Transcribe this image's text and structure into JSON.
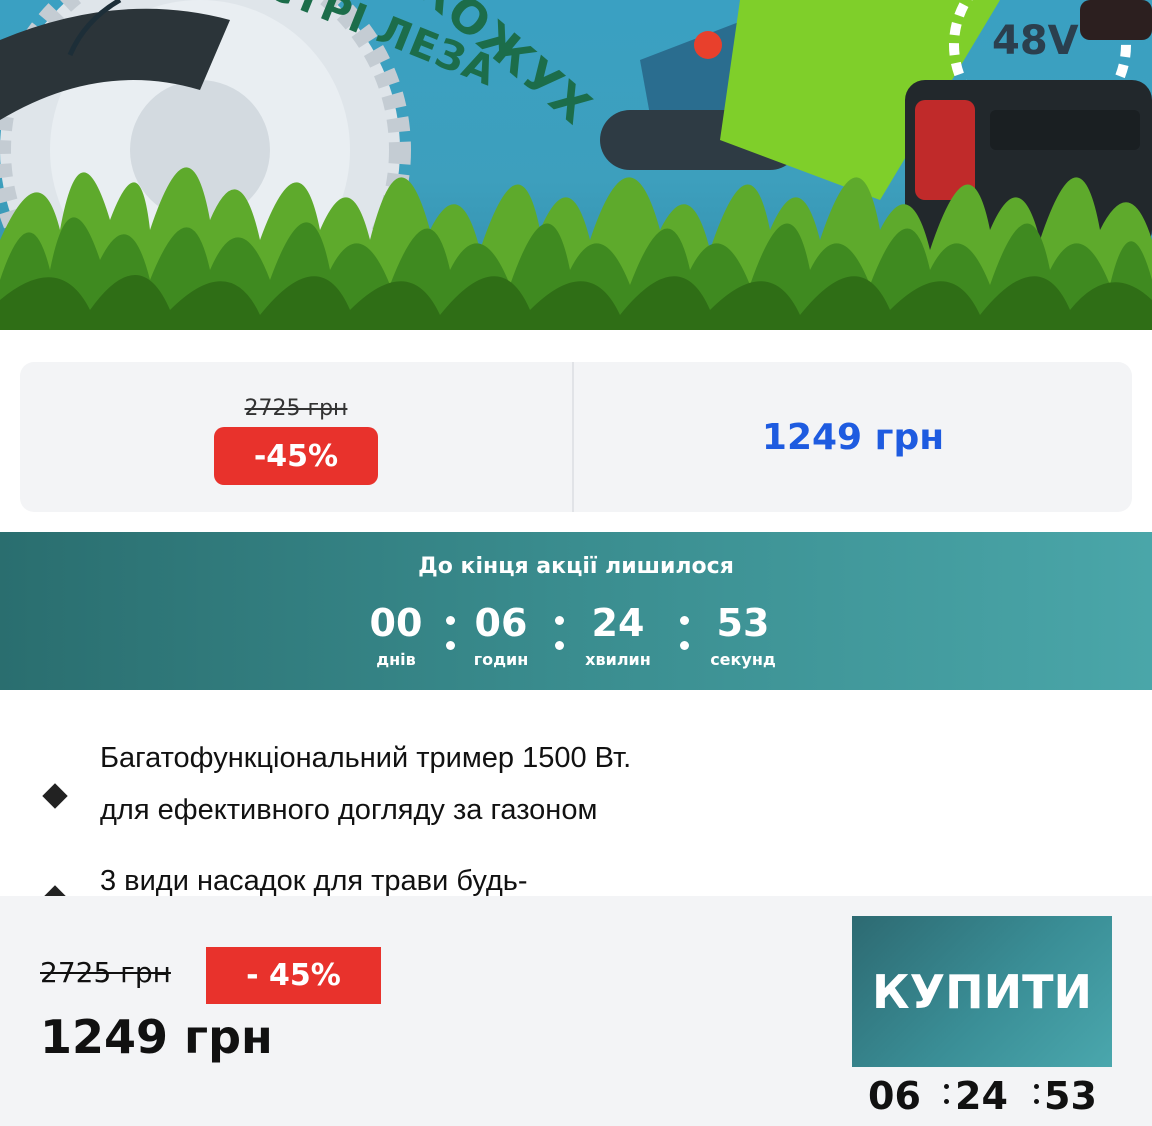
{
  "hero": {
    "arc_text": "ГОСТРІ ЛЕЗА",
    "arc_text_2": "КОЖУХ",
    "voltage_badge": "48V"
  },
  "price_card": {
    "old_price": "2725 грн",
    "discount": "-45%",
    "new_price": "1249 грн"
  },
  "countdown": {
    "title": "До кінця акції лишилося",
    "units": [
      {
        "value": "00",
        "label": "днів"
      },
      {
        "value": "06",
        "label": "годин"
      },
      {
        "value": "24",
        "label": "хвилин"
      },
      {
        "value": "53",
        "label": "секунд"
      }
    ]
  },
  "features": [
    {
      "line1": "Багатофункціональний тример 1500 Вт.",
      "line2": "для ефективного догляду за газоном"
    },
    {
      "line1": "3 види насадок для трави будь-",
      "line2": ""
    }
  ],
  "bottom_bar": {
    "old_price": "2725 грн",
    "discount": "- 45%",
    "new_price": "1249 грн",
    "buy_label": "КУПИТИ",
    "timer": {
      "hours": "06",
      "minutes": "24",
      "seconds": "53"
    }
  },
  "colors": {
    "accent_red": "#e8322c",
    "price_blue": "#1e5be0",
    "teal": "#3a8d8f"
  }
}
